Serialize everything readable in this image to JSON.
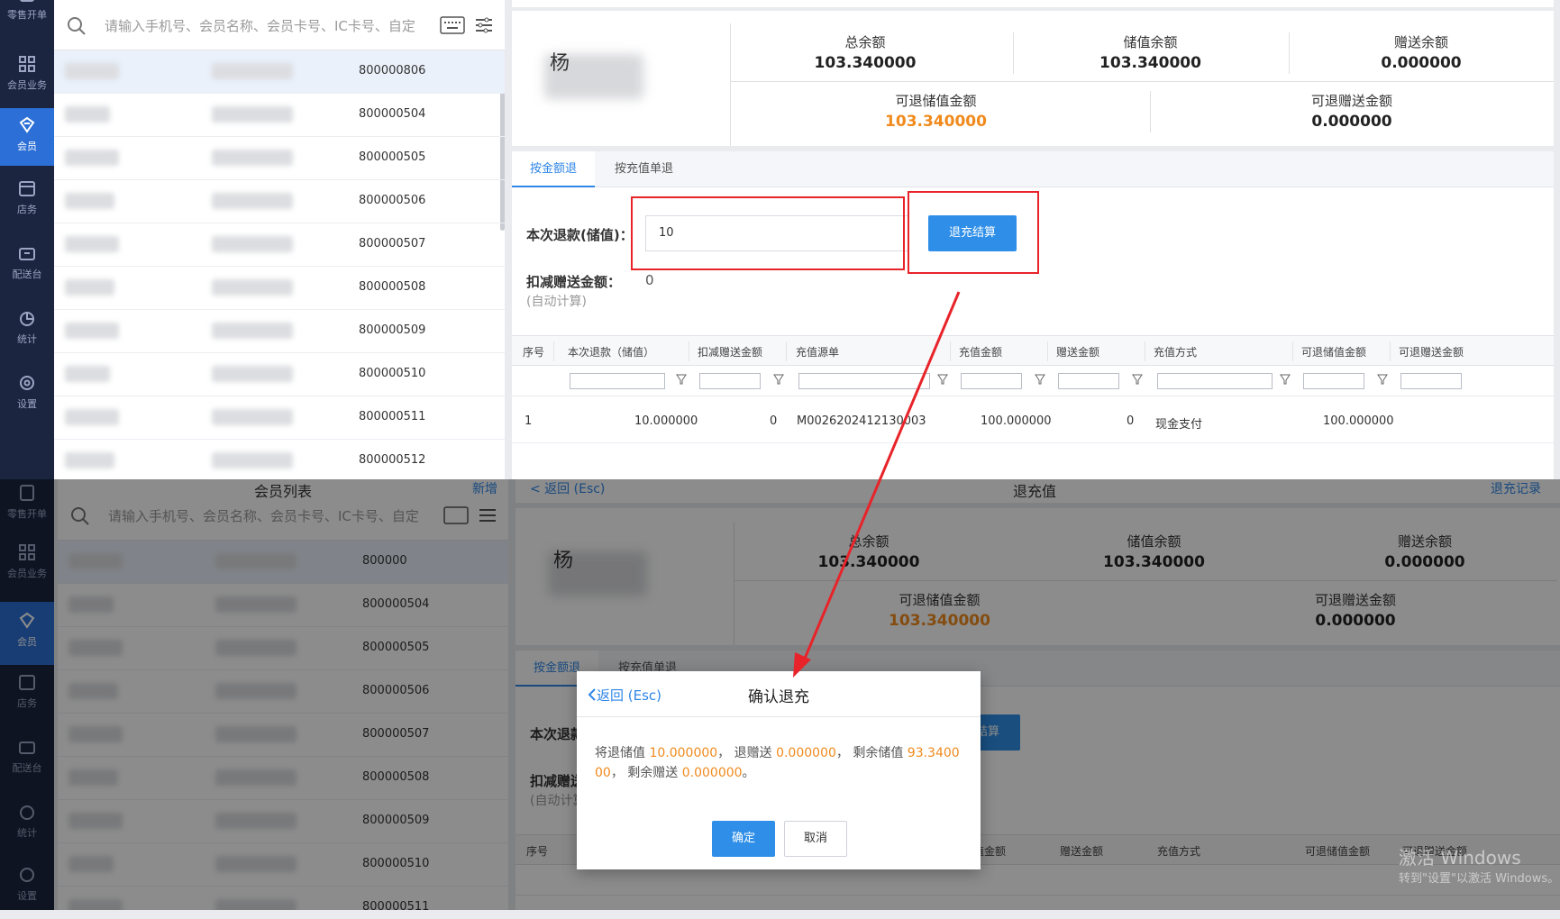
{
  "sidebar": {
    "items": [
      {
        "label": "零售开单",
        "icon": "receipt-icon"
      },
      {
        "label": "会员业务",
        "icon": "grid-icon"
      },
      {
        "label": "会员",
        "icon": "diamond-icon"
      },
      {
        "label": "店务",
        "icon": "store-icon"
      },
      {
        "label": "配送台",
        "icon": "delivery-icon"
      },
      {
        "label": "统计",
        "icon": "pie-chart-icon"
      },
      {
        "label": "设置",
        "icon": "gear-icon"
      }
    ]
  },
  "member_list": {
    "search_placeholder": "请输入手机号、会员名称、会员卡号、IC卡号、自定",
    "top_cards": [
      "800000806",
      "800000504",
      "800000505",
      "800000506",
      "800000507",
      "800000508",
      "800000509",
      "800000510",
      "800000511",
      "800000512"
    ],
    "bottom_cards": [
      "800000",
      "800000504",
      "800000505",
      "800000506",
      "800000507",
      "800000508",
      "800000509",
      "800000510",
      "800000511"
    ],
    "bottom_header_title": "会员列表",
    "bottom_header_action": "新增"
  },
  "detail": {
    "member_name": "杨",
    "balances": {
      "total_label": "总余额",
      "total_value": "103.340000",
      "stored_label": "储值余额",
      "stored_value": "103.340000",
      "gift_label": "赠送余额",
      "gift_value": "0.000000",
      "refundable_stored_label": "可退储值金额",
      "refundable_stored_value": "103.340000",
      "refundable_gift_label": "可退赠送金额",
      "refundable_gift_value": "0.000000"
    },
    "tabs": [
      "按金额退",
      "按充值单退"
    ],
    "refund_label": "本次退款(储值)：",
    "refund_value": "10",
    "settle_button": "退充结算",
    "deduct_label": "扣减赠送金额：",
    "deduct_value": "0",
    "auto_calc": "(自动计算)",
    "grid": {
      "headers": [
        "序号",
        "本次退款（储值）",
        "扣减赠送金额",
        "充值源单",
        "充值金额",
        "赠送金额",
        "充值方式",
        "可退储值金额",
        "可退赠送金额"
      ],
      "row": [
        "1",
        "10.000000",
        "0",
        "M0026202412130003",
        "100.000000",
        "0",
        "现金支付",
        "100.000000"
      ]
    },
    "bottom_header_back": "< 返回 (Esc)",
    "bottom_header_title": "退充值",
    "bottom_header_action": "退充记录"
  },
  "modal": {
    "back": "返回 (Esc)",
    "title": "确认退充",
    "msg_1": "将退储值 ",
    "refund_stored": "10.000000",
    "msg_2": "， 退赠送 ",
    "refund_gift": "0.000000",
    "msg_3": "， 剩余储值 ",
    "remain_stored": "93.340000",
    "msg_4": "， 剩余赠送 ",
    "remain_gift": "0.000000",
    "msg_5": "。",
    "ok": "确定",
    "cancel": "取消"
  },
  "watermark": {
    "line1": "激活 Windows",
    "line2": "转到\"设置\"以激活 Windows。"
  },
  "colors": {
    "accent": "#2f8fe8",
    "orange": "#f08a1c",
    "sidebar": "#1c2540",
    "annotation_red": "#e8232a"
  }
}
